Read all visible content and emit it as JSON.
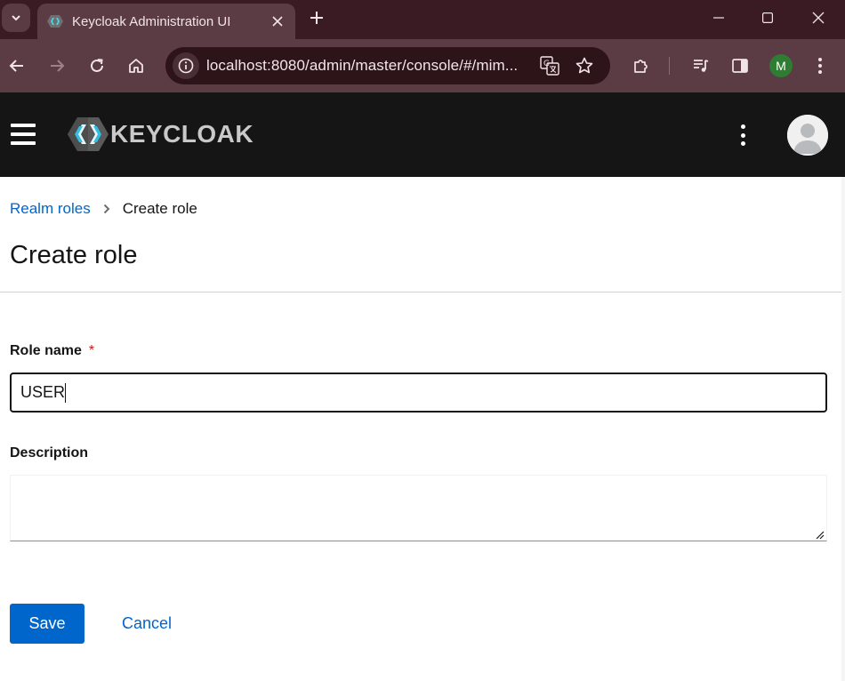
{
  "browser": {
    "tab_title": "Keycloak Administration UI",
    "url": "localhost:8080/admin/master/console/#/mim...",
    "profile_initial": "M",
    "colors": {
      "tabstrip": "#3a1b24",
      "toolbar": "#5b3b44",
      "omnibox": "#2d1419",
      "profile": "#2e7d32"
    }
  },
  "app": {
    "logo_text": "KEYCLOAK",
    "header_color": "#151515"
  },
  "breadcrumb": {
    "parent": "Realm roles",
    "current": "Create role"
  },
  "page": {
    "title": "Create role"
  },
  "form": {
    "role_name_label": "Role name",
    "required_marker": "*",
    "role_name_value": "USER",
    "description_label": "Description",
    "description_value": ""
  },
  "actions": {
    "save_label": "Save",
    "cancel_label": "Cancel",
    "primary_color": "#0066cc"
  },
  "icons": {
    "tab_search": "chevron-down-icon",
    "close": "close-icon",
    "new_tab": "plus-icon",
    "back": "arrow-left-icon",
    "forward": "arrow-right-icon",
    "reload": "reload-icon",
    "home": "home-icon",
    "site_info": "info-icon",
    "translate": "translate-icon",
    "bookmark": "star-icon",
    "extensions": "puzzle-icon",
    "media": "media-control-icon",
    "side_panel": "side-panel-icon",
    "menu": "kebab-menu-icon"
  }
}
